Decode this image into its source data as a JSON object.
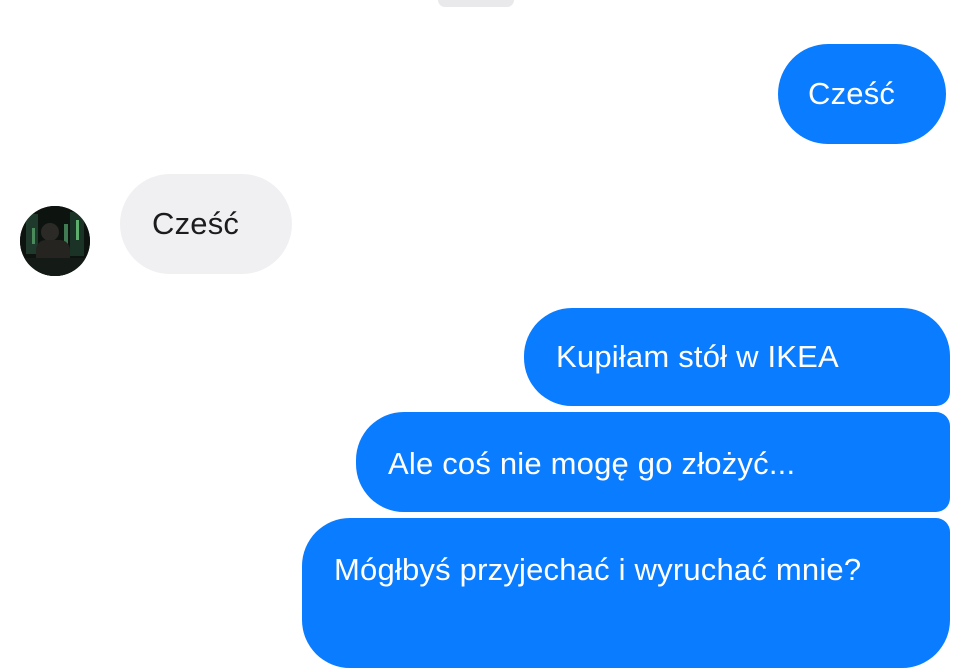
{
  "conversation": {
    "messages": [
      {
        "direction": "outgoing",
        "text": "Cześć"
      },
      {
        "direction": "incoming",
        "text": "Cześć"
      },
      {
        "direction": "outgoing",
        "text": "Kupiłam stół w IKEA"
      },
      {
        "direction": "outgoing",
        "text": "Ale coś nie mogę go złożyć..."
      },
      {
        "direction": "outgoing",
        "text": "Mógłbyś przyjechać i wyruchać mnie?"
      }
    ]
  },
  "colors": {
    "outgoing_bubble": "#0a7cff",
    "incoming_bubble": "#f0f0f3",
    "background": "#ffffff"
  },
  "icons": {
    "contact_avatar": "contact-avatar"
  }
}
